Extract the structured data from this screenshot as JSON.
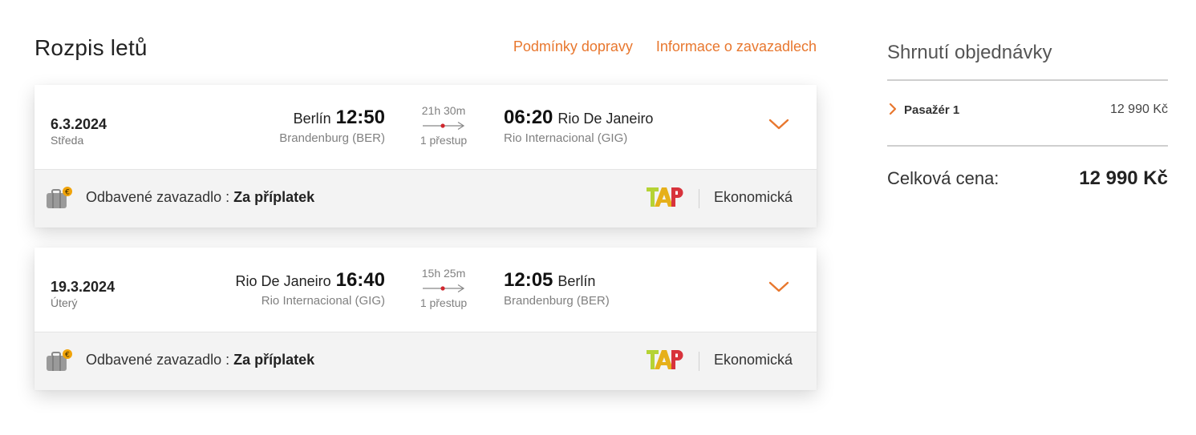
{
  "header": {
    "title": "Rozpis letů",
    "links": [
      "Podmínky dopravy",
      "Informace o zavazadlech"
    ]
  },
  "flights": [
    {
      "date": "6.3.2024",
      "day": "Středa",
      "dep_city": "Berlín",
      "dep_time": "12:50",
      "dep_airport": "Brandenburg (BER)",
      "duration": "21h 30m",
      "stops": "1 přestup",
      "arr_time": "06:20",
      "arr_city": "Rio De Janeiro",
      "arr_airport": "Rio Internacional (GIG)",
      "expand_icon": "chevron-down-icon",
      "baggage_label": "Odbavené zavazadlo :",
      "baggage_value": "Za příplatek",
      "airline_logo_text": "TAP",
      "cabin": "Ekonomická"
    },
    {
      "date": "19.3.2024",
      "day": "Úterý",
      "dep_city": "Rio De Janeiro",
      "dep_time": "16:40",
      "dep_airport": "Rio Internacional (GIG)",
      "duration": "15h 25m",
      "stops": "1 přestup",
      "arr_time": "12:05",
      "arr_city": "Berlín",
      "arr_airport": "Brandenburg (BER)",
      "expand_icon": "chevron-down-icon",
      "baggage_label": "Odbavené zavazadlo :",
      "baggage_value": "Za příplatek",
      "airline_logo_text": "TAP",
      "cabin": "Ekonomická"
    }
  ],
  "summary": {
    "title": "Shrnutí objednávky",
    "passenger_label": "Pasažér 1",
    "passenger_price": "12 990 Kč",
    "total_label": "Celková cena:",
    "total_value": "12 990 Kč"
  },
  "colors": {
    "accent": "#e8772e",
    "card_footer": "#f3f3f3",
    "route_dot": "#d0262d"
  }
}
